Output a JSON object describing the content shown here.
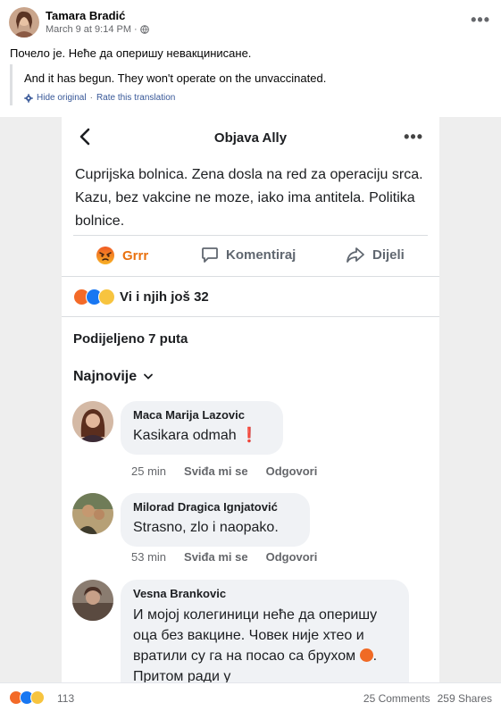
{
  "post": {
    "author": "Tamara Bradić",
    "time": "March 9 at 9:14 PM",
    "separator": "·",
    "text": "Почело је. Неће да оперишу невакцинисане.",
    "translation": "And it has begun. They won't operate on the unvaccinated.",
    "hide_original": "Hide original",
    "link_separator": "·",
    "rate_translation": "Rate this translation",
    "more": "•••"
  },
  "screenshot": {
    "title": "Objava Ally",
    "more": "•••",
    "body": "Cuprijska bolnica. Zena dosla na red za operaciju srca. Kazu, bez vakcine ne moze, iako ima antitela. Politika bolnice.",
    "actions": {
      "grrr": "Grrr",
      "comment": "Komentiraj",
      "share": "Dijeli"
    },
    "reactions_label": "Vi i njih još 32",
    "shared": "Podijeljeno 7 puta",
    "sort": "Najnovije",
    "comments": [
      {
        "name": "Maca Marija Lazovic",
        "text": "Kasikara odmah",
        "time": "25 min",
        "like": "Sviđa mi se",
        "reply": "Odgovori"
      },
      {
        "name": "Milorad Dragica Ignjatović",
        "text": "Strasno, zlo i naopako.",
        "time": "53 min",
        "like": "Sviđa mi se",
        "reply": "Odgovori"
      },
      {
        "name": "Vesna Brankovic",
        "text": "И мојој колегиници неће да оперишу оца без вакцине. Човек није хтео и вратили су га на посао са брухом",
        "text_tail": ". Притом ради у",
        "time": "",
        "like": "",
        "reply": ""
      }
    ]
  },
  "footer": {
    "reactions": "113",
    "comments": "25 Comments",
    "shares": "259 Shares"
  },
  "colors": {
    "link": "#385898",
    "secondary": "#65676b",
    "angry": "#e9710f",
    "like": "#1877f2",
    "bubble": "#f0f2f5"
  }
}
